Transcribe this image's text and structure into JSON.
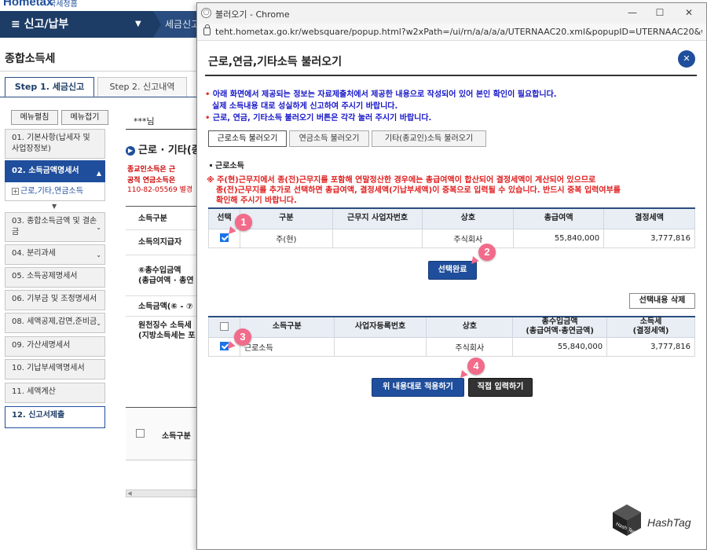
{
  "background": {
    "logo": "Hometax",
    "logo_sub": "국세청홈",
    "nav_menu": "신고/납부",
    "breadcrumb": "세금신고",
    "page_title": "종합소득세",
    "steps": [
      "Step 1. 세금신고",
      "Step 2. 신고내역"
    ],
    "menu_buttons": [
      "메뉴펼침",
      "메뉴접기"
    ],
    "sidebar": [
      {
        "label": "01. 기본사항(납세자 및 사업장정보)"
      },
      {
        "label": "02. 소득금액명세서"
      },
      {
        "label": "03. 종합소득금액 및 결손금"
      },
      {
        "label": "04. 분리과세"
      },
      {
        "label": "05. 소득공제명세서"
      },
      {
        "label": "06. 기부금 및 조정명세서"
      },
      {
        "label": "08. 세액공제,감면,준비금"
      },
      {
        "label": "09. 가산세명세서"
      },
      {
        "label": "10. 기납부세액명세서"
      },
      {
        "label": "11. 세액계산"
      },
      {
        "label": "12. 신고서제출"
      }
    ],
    "subitem": "근로,기타,연금소득",
    "user": "***님",
    "mid_heading": "근로 · 기타(종",
    "mid_notes": [
      "종교인소득은 근",
      "공적 연금소득은"
    ],
    "mid_number": "110-82-05569 별경",
    "mid_rows": [
      "소득구분",
      "소득의지급자",
      "⑥총수입금액\n(총급여액 · 총연",
      "소득금액(⑥ - ⑦",
      "원천징수 소득세\n(지방소득세는 포"
    ],
    "mid_grid_col": "소득구분"
  },
  "window": {
    "title": "불러오기 - Chrome",
    "url": "teht.hometax.go.kr/websquare/popup.html?w2xPath=/ui/rn/a/a/a/a/UTERNAAC20.xml&popupID=UTERNAAC20&w2..."
  },
  "popup": {
    "heading": "근로,연금,기타소득 불러오기",
    "notices": [
      "아래 화면에서 제공되는 정보는 자료제출처에서 제공한 내용으로 작성되어 있어 본인 확인이 필요합니다.",
      "실제 소득내용 대로 성실하게 신고하여 주시기 바랍니다.",
      "근로, 연금, 기타소득 불러오기 버튼은 각각 눌러 주시기 바랍니다."
    ],
    "tabs": [
      "근로소득 불러오기",
      "연금소득 불러오기",
      "기타(종교인)소득 불러오기"
    ],
    "section": "근로소득",
    "warning": [
      "※ 주(현)근무지에서 종(전)근무지를 포함해 연말정산한 경우에는 총급여액이 합산되어 결정세액이 계산되어 있으므로",
      "종(전)근무지를 추가로 선택하면 총급여액, 결정세액(기납부세액)이 중복으로 입력될 수 있습니다. 반드시 중복 입력여부를",
      "확인해 주시기 바랍니다."
    ],
    "table1": {
      "headers": [
        "선택",
        "구분",
        "근무지 사업자번호",
        "상호",
        "총급여액",
        "결정세액"
      ],
      "rows": [
        {
          "type": "주(현)",
          "bizno": "",
          "name": "주식회사",
          "salary": "55,840,000",
          "tax": "3,777,816"
        }
      ]
    },
    "select_done": "선택완료",
    "delete_selected": "선택내용 삭제",
    "table2": {
      "headers": [
        "",
        "소득구분",
        "사업자등록번호",
        "상호",
        "총수입금액\n(총급여액·총연금액)",
        "소득세\n(결정세액)"
      ],
      "rows": [
        {
          "type": "근로소득",
          "bizno": "",
          "name": "주식회사",
          "income": "55,840,000",
          "tax": "3,777,816"
        }
      ]
    },
    "apply_button": "위 내용대로 적용하기",
    "direct_button": "직접 입력하기"
  },
  "markers": [
    "1",
    "2",
    "3",
    "4"
  ],
  "watermark": {
    "cube": "Hash Tag",
    "text": "HashTag"
  },
  "colors": {
    "accent": "#1f4e9c",
    "marker": "#f26b8a",
    "warning": "#e01f1f",
    "notice": "#1616c8"
  }
}
